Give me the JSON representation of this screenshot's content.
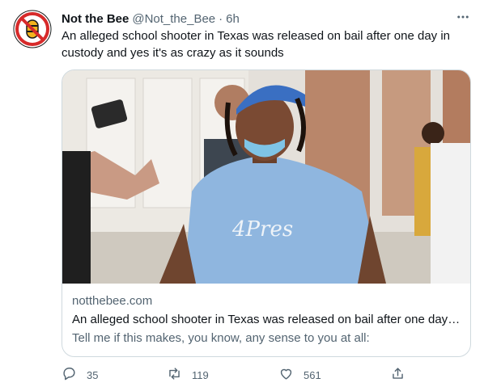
{
  "tweet": {
    "author": {
      "display_name": "Not the Bee",
      "handle": "@Not_the_Bee",
      "separator": "·",
      "time": "6h"
    },
    "text": "An alleged school shooter in Texas was released on bail after one day in custody and yes it's as crazy as it sounds",
    "card": {
      "domain": "notthebee.com",
      "title": "An alleged school shooter in Texas was released on bail after one day in custody and yes it's as crazy as it sounds",
      "description": "Tell me if this makes, you know, any sense to you at all:",
      "image_text": "4Pres"
    },
    "actions": {
      "replies": "35",
      "retweets": "119",
      "likes": "561"
    }
  },
  "colors": {
    "text_primary": "#0f1419",
    "text_secondary": "#536471",
    "border": "#cfd9de",
    "brand_red": "#d72a2a",
    "brand_yellow": "#f2b31d"
  },
  "icons": [
    "avatar-logo",
    "more-icon",
    "reply-icon",
    "retweet-icon",
    "like-icon",
    "share-icon"
  ]
}
